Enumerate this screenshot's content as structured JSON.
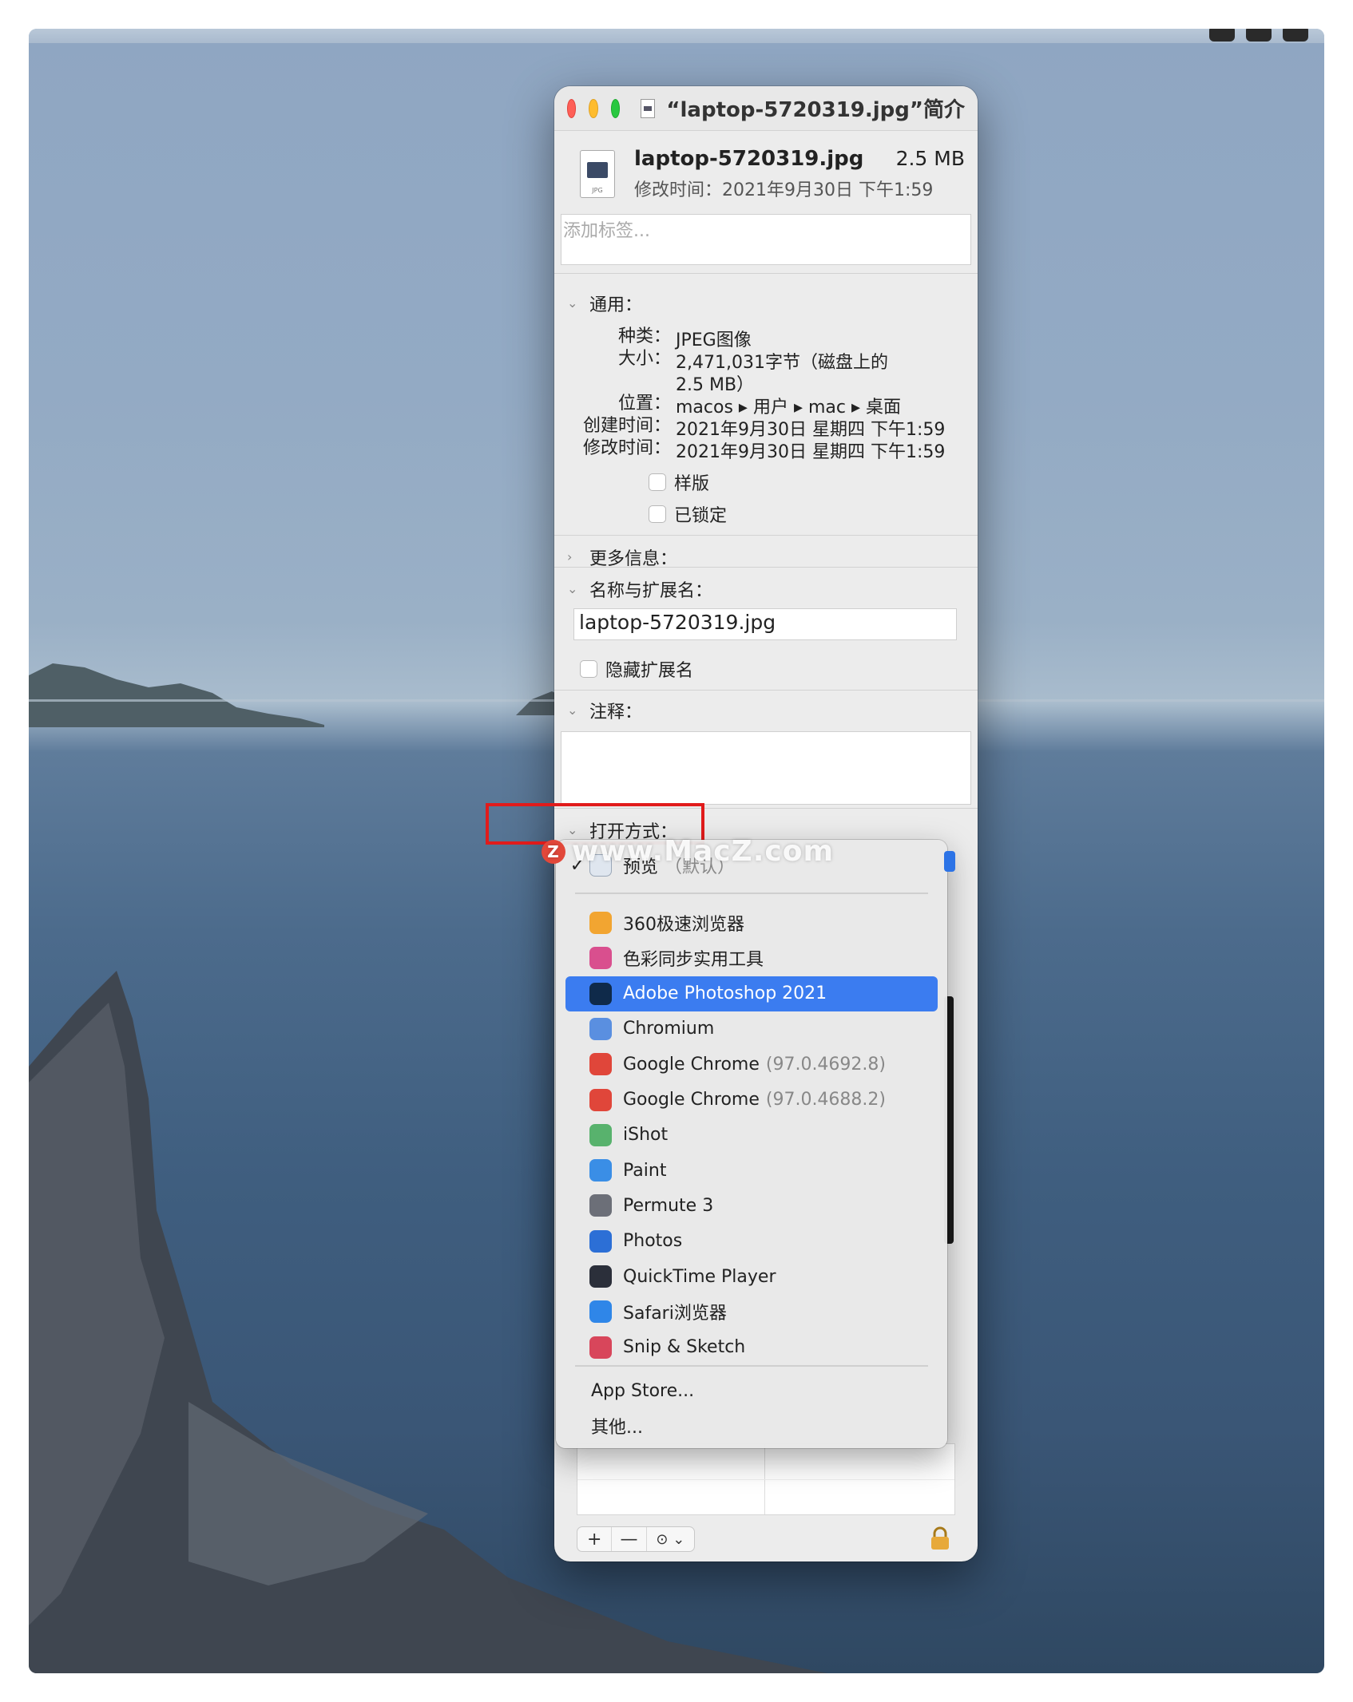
{
  "window": {
    "title": "“laptop-5720319.jpg”简介",
    "file_name": "laptop-5720319.jpg",
    "file_size": "2.5 MB",
    "modified_line": "修改时间：2021年9月30日 下午1:59",
    "file_icon_label": "JPG",
    "tags_placeholder": "添加标签..."
  },
  "general": {
    "header": "通用：",
    "rows": [
      {
        "key": "种类：",
        "value": "JPEG图像"
      },
      {
        "key": "大小：",
        "value": "2,471,031字节（磁盘上的"
      },
      {
        "key": "",
        "value": "2.5 MB）"
      },
      {
        "key": "位置：",
        "value": "macos ▸ 用户 ▸ mac ▸ 桌面"
      },
      {
        "key": "创建时间：",
        "value": "2021年9月30日 星期四 下午1:59"
      },
      {
        "key": "修改时间：",
        "value": "2021年9月30日 星期四 下午1:59"
      }
    ],
    "checkboxes": [
      "样版",
      "已锁定"
    ]
  },
  "more_info": {
    "header": "更多信息："
  },
  "name_ext": {
    "header": "名称与扩展名：",
    "value": "laptop-5720319.jpg",
    "hide_ext_label": "隐藏扩展名"
  },
  "comments": {
    "header": "注释："
  },
  "open_with": {
    "header": "打开方式："
  },
  "popup": {
    "default_item": {
      "name": "预览",
      "suffix": "（默认）",
      "checked": true
    },
    "apps": [
      {
        "name": "360极速浏览器",
        "version": "",
        "icon": "360-browser-icon",
        "color": "#f2a531"
      },
      {
        "name": "色彩同步实用工具",
        "version": "",
        "icon": "colorsync-icon",
        "color": "#d94f8e"
      },
      {
        "name": "Adobe Photoshop 2021",
        "version": "",
        "icon": "photoshop-icon",
        "color": "#0f2a4a",
        "selected": true
      },
      {
        "name": "Chromium",
        "version": "",
        "icon": "chromium-icon",
        "color": "#5a8fe0"
      },
      {
        "name": "Google Chrome",
        "version": "(97.0.4692.8)",
        "icon": "chrome-icon",
        "color": "#e0463a"
      },
      {
        "name": "Google Chrome",
        "version": "(97.0.4688.2)",
        "icon": "chrome-icon",
        "color": "#e0463a"
      },
      {
        "name": "iShot",
        "version": "",
        "icon": "ishot-icon",
        "color": "#58b26d"
      },
      {
        "name": "Paint",
        "version": "",
        "icon": "paint-icon",
        "color": "#3a8ee6"
      },
      {
        "name": "Permute 3",
        "version": "",
        "icon": "permute-icon",
        "color": "#6c6f78"
      },
      {
        "name": "Photos",
        "version": "",
        "icon": "photos-icon",
        "color": "#2c6fd6"
      },
      {
        "name": "QuickTime Player",
        "version": "",
        "icon": "quicktime-icon",
        "color": "#2b2f3a"
      },
      {
        "name": "Safari浏览器",
        "version": "",
        "icon": "safari-icon",
        "color": "#2f86e8"
      },
      {
        "name": "Snip & Sketch",
        "version": "",
        "icon": "snip-sketch-icon",
        "color": "#d8465b"
      }
    ],
    "app_store": "App Store...",
    "other": "其他..."
  },
  "toolbar": {
    "add": "+",
    "remove": "—",
    "action": "⊙ ⌄"
  },
  "watermark": {
    "z": "Z",
    "text": "www.MacZ.com"
  }
}
